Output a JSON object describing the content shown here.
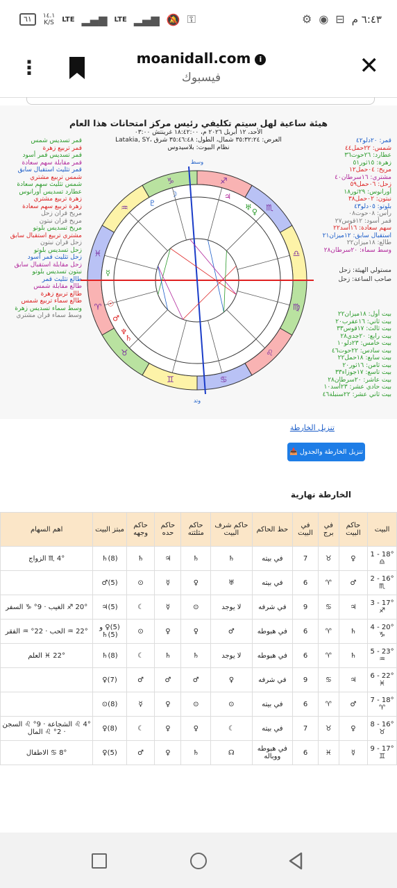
{
  "status": {
    "time": "٦:٤٣ م",
    "battery": "٦١",
    "speed": "١٤.١",
    "speed_unit": "K/S",
    "net1": "LTE",
    "net2": "LTE"
  },
  "toolbar": {
    "url": "moanidall.com",
    "subtitle": "فيسبوك"
  },
  "chart": {
    "title": "هيئة ساعية لهل سيتم تكليفي رئيس مركز امتحانات هذا العام",
    "line1": "الأحد، ١٢ أبريل ٢٠٢٦ م، ١٨:٤٢:٠٠ غرينتش ٠٣:٠٠",
    "line2": "Latakia, SY، العرض: ٣٥:٣٢:٢٤ شمال، الطول: ٣٥:٤٦:٤٨ شرق",
    "line3": "نظام البيوت: بلاسيدوس",
    "top_label": "وسط",
    "bottom_label": "وتد",
    "left_aspects": [
      "قمر تسديس شمس",
      "قمر تربيع زهرة",
      "قمر تسديس قمر أسود",
      "قمر مقابلة سهم سعادة",
      "قمر تثليث استقبال سابق",
      "شمس تربيع مشتري",
      "شمس تثليث سهم سعادة",
      "عطارد تسديس أورانوس",
      "زهرة تربيع مشتري",
      "زهرة تربيع سهم سعادة",
      "مريخ قران زحل",
      "مريخ قران نبتون",
      "مريخ تسديس بلوتو",
      "مشتري تربيع استقبال سابق",
      "زحل قران نبتون",
      "زحل تسديس بلوتو",
      "زحل تثليث قمر أسود",
      "زحل مقابلة استقبال سابق",
      "نبتون تسديس بلوتو",
      "طالع تثليث قمر",
      "طالع مقابلة شمس",
      "طالع تربيع زهرة",
      "طالع سماء تربيع شمس",
      "وسط سماء تسديس زهرة",
      "وسط سماء قران مشتري"
    ],
    "left_colors": [
      "#2a9a2a",
      "#d22",
      "#2a9a2a",
      "#b0259a",
      "#1a5cc8",
      "#d22",
      "#2a9a2a",
      "#2a9a2a",
      "#d22",
      "#d22",
      "#777",
      "#777",
      "#2a9a2a",
      "#d22",
      "#777",
      "#2a9a2a",
      "#1a5cc8",
      "#b0259a",
      "#2a9a2a",
      "#1a5cc8",
      "#b0259a",
      "#d22",
      "#d22",
      "#2a9a2a",
      "#777"
    ],
    "right_planets": [
      "قمر: ٢٠دلو٤٢",
      "شمس: ٢٢حمل٤٤",
      "عطارد: ٢٦حوت٣٦",
      "زهرة: ١٥ثور٥١",
      "مريخ: ٠٤حمل١٢",
      "مشتري: ١٦سرطان٤٠",
      "زحل: ٠٦حمل٥٩",
      "أورانوس: ٢٩ثور١٨",
      "نبتون: ٠٢حمل٣٨",
      "بلوتو: ٠٥دلو٤٣",
      "رأس: ٠٨حوت٠٨",
      "قمر أسود: ١٢قوس٢٧",
      "سهم سعادة: ١٦أسد٢٢",
      "استقبال سابق: ١٢ميزان٢١",
      "طالع: ١٨ميزان٢٢",
      "وسط سماء: ٢٠سرطان٢٨"
    ],
    "right_colors": [
      "#1a5cc8",
      "#d22",
      "#2a9a2a",
      "#2a9a2a",
      "#d22",
      "#b0259a",
      "#d22",
      "#2a9a2a",
      "#d22",
      "#1a5cc8",
      "#777",
      "#777",
      "#d22",
      "#1a5cc8",
      "#777",
      "#b0259a"
    ],
    "right_mid": [
      "مستولي الهيئة: زحل",
      "صاحب الساعة: زحل"
    ],
    "right_houses": [
      "بيت أول: ١٨ميزان٢٢",
      "بيت ثاني: ١٦عقرب٢٠",
      "بيت ثالث: ١٧قوس٣٣",
      "بيت رابع: ٢٠جدي٢٨",
      "بيت خامس: ٢٣دلو١٠",
      "بيت سادس: ٢٢حوت٤٦",
      "بيت سابع: ١٨حمل٢٢",
      "بيت ثامن: ١٦ثور٢٠",
      "بيت تاسع: ١٧جوزاء٣٣",
      "بيت عاشر: ٢٠سرطان٢٨",
      "بيت حادي عشر: ٢٣أسد١٠",
      "بيت ثاني عشر: ٢٢سنبلة٤٦"
    ]
  },
  "download_link": "تنزيل الخارطة",
  "download_button": "📥 تنزيل الخارطة والجدول",
  "section_title": "الخارطة نهارية",
  "table": {
    "headers": [
      "البيت",
      "حاكم البيت",
      "في برج",
      "في البيت",
      "حظ الحاكم",
      "حاكم شرف البيت",
      "حاكم مثلثته",
      "حاكم حده",
      "حاكم وجهه",
      "مبتز البيت",
      "اهم السهام"
    ],
    "rows": [
      [
        "18° - 1 ♎",
        "♀",
        "♉",
        "7",
        "في بيته",
        "♄",
        "♄",
        "♃",
        "♄",
        "(8)♄",
        "4° ♏ الزواج"
      ],
      [
        "16° - 2 ♏",
        "♂",
        "♈",
        "6",
        "في بيته",
        "♅",
        "♀",
        "☿",
        "⊙",
        "(5)♂",
        ""
      ],
      [
        "17° - 3 ♐",
        "♃",
        "♋",
        "9",
        "في شرفه",
        "لا يوجد",
        "⊙",
        "☿",
        "☾",
        "(5)♃",
        "20° ♐ الغيب · 9° ♑ السفر"
      ],
      [
        "20° - 4 ♑",
        "♄",
        "♈",
        "6",
        "في هبوطه",
        "♂",
        "♀",
        "♀",
        "⊙",
        "(5)♀ و (5)♄",
        "22° ♒ الحب · 22° ♒ الفقر"
      ],
      [
        "23° - 5 ♒",
        "♄",
        "♈",
        "6",
        "في هبوطه",
        "لا يوجد",
        "♄",
        "♄",
        "☾",
        "(8)♄",
        "22° ♓ العلم"
      ],
      [
        "22° - 6 ♓",
        "♃",
        "♋",
        "9",
        "في شرفه",
        "♀",
        "♂",
        "♂",
        "♂",
        "(7)♀",
        ""
      ],
      [
        "18° - 7 ♈",
        "♂",
        "♈",
        "6",
        "في بيته",
        "⊙",
        "⊙",
        "♀",
        "☿",
        "(8)⊙",
        ""
      ],
      [
        "16° - 8 ♉",
        "♀",
        "♉",
        "7",
        "في بيته",
        "☾",
        "♀",
        "♀",
        "☾",
        "(8)♀",
        "4° ♌ الشجاعة · 9° ♌ السجن · 2° ♌ المال"
      ],
      [
        "17° - 9 ♊",
        "☿",
        "♓",
        "6",
        "في هبوطه ووباله",
        "☊",
        "♄",
        "♀",
        "♂",
        "(5)♀",
        "8° ♋ الاطفال"
      ]
    ]
  }
}
